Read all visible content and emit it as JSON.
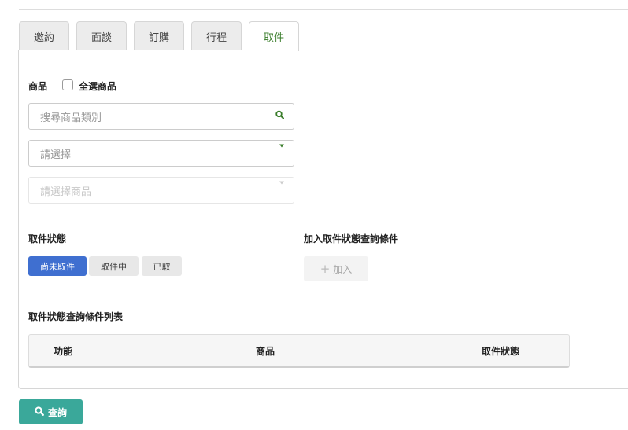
{
  "tabs": [
    {
      "label": "邀約",
      "active": false
    },
    {
      "label": "面談",
      "active": false
    },
    {
      "label": "訂購",
      "active": false
    },
    {
      "label": "行程",
      "active": false
    },
    {
      "label": "取件",
      "active": true
    }
  ],
  "product": {
    "label": "商品",
    "select_all_label": "全選商品",
    "select_all_checked": false,
    "search_placeholder": "搜尋商品類別",
    "category_placeholder": "請選擇",
    "product_placeholder": "請選擇商品"
  },
  "pickup_status": {
    "label": "取件狀態",
    "options": [
      {
        "label": "尚未取件",
        "selected": true
      },
      {
        "label": "取件中",
        "selected": false
      },
      {
        "label": "已取",
        "selected": false
      }
    ]
  },
  "add_condition": {
    "label": "加入取件狀態查詢條件",
    "button_label": "加入"
  },
  "condition_list": {
    "label": "取件狀態查詢條件列表",
    "columns": [
      "功能",
      "商品",
      "取件狀態"
    ]
  },
  "query_button_label": "查詢",
  "colors": {
    "accent_green": "#3a7d2b",
    "selected_blue": "#3f6fd0",
    "query_teal": "#3aa89a"
  },
  "icons": {
    "search": "search-icon",
    "dropdown": "caret-down-icon",
    "plus": "plus-icon"
  }
}
